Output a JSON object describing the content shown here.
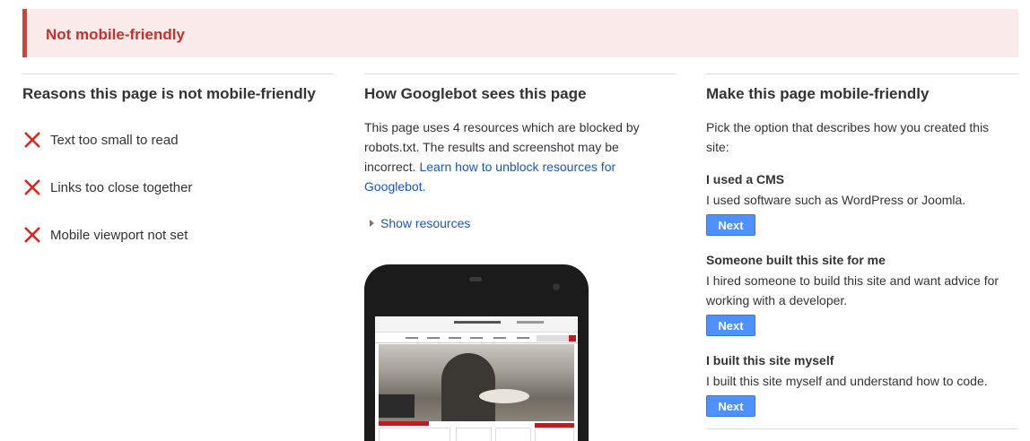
{
  "banner": {
    "title": "Not mobile-friendly"
  },
  "reasons": {
    "title": "Reasons this page is not mobile-friendly",
    "items": [
      {
        "label": "Text too small to read",
        "icon": "x-icon"
      },
      {
        "label": "Links too close together",
        "icon": "x-icon"
      },
      {
        "label": "Mobile viewport not set",
        "icon": "x-icon"
      }
    ]
  },
  "googlebot": {
    "title": "How Googlebot sees this page",
    "description": "This page uses 4 resources which are blocked by robots.txt. The results and screenshot may be incorrect. ",
    "link": "Learn how to unblock resources for Googlebot.",
    "show_resources": "Show resources"
  },
  "fix": {
    "title": "Make this page mobile-friendly",
    "intro": "Pick the option that describes how you created this site:",
    "options": [
      {
        "title": "I used a CMS",
        "description": "I used software such as WordPress or Joomla.",
        "button": "Next"
      },
      {
        "title": "Someone built this site for me",
        "description": "I hired someone to build this site and want advice for working with a developer.",
        "button": "Next"
      },
      {
        "title": "I built this site myself",
        "description": "I built this site myself and understand how to code.",
        "button": "Next"
      }
    ]
  },
  "colors": {
    "error_red": "#c9302c",
    "banner_bg": "#fbeceb",
    "link_blue": "#1a55c7",
    "button_blue": "#4d90fe"
  }
}
